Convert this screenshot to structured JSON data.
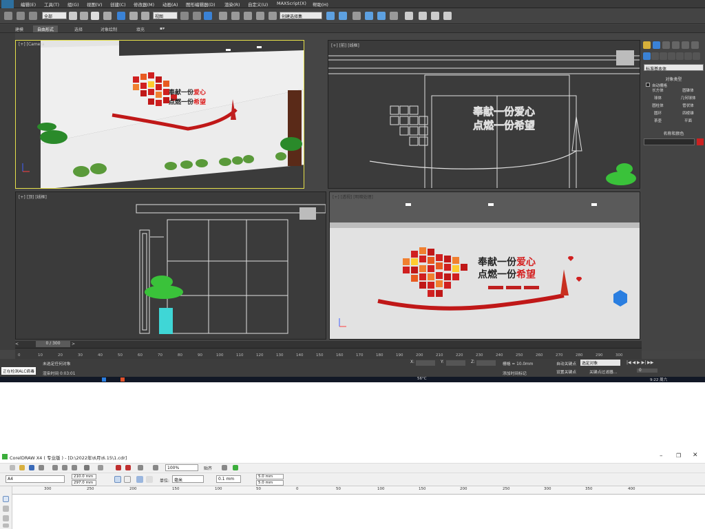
{
  "max": {
    "menu": [
      "编辑(E)",
      "工具(T)",
      "组(G)",
      "视图(V)",
      "创建(C)",
      "修改器(M)",
      "动画(A)",
      "图形编辑器(D)",
      "渲染(R)",
      "自定义(U)",
      "MAXScript(X)",
      "帮助(H)"
    ],
    "selection_filter": "全部",
    "view_dropdown": "视图",
    "named_selection": "创建选择集",
    "ribbon_tabs": [
      "建模",
      "自由形式",
      "选择",
      "对象绘制",
      "填充"
    ],
    "viewports": {
      "camera": "[+] [Camera",
      "front": "[+] [前] [线框]",
      "top": "[+] [顶] [线框]",
      "perspective": "[+] [透视] [明暗处理]"
    },
    "wall_text": {
      "line1_a": "奉献一份",
      "line1_b": "爱心",
      "line2_a": "点燃一份",
      "line2_b": "希望"
    },
    "command_panel": {
      "primitive_dropdown": "标准基本体",
      "object_type_header": "对象类型",
      "autogrid_label": "自动栅格",
      "buttons": [
        "长方体",
        "圆锥体",
        "球体",
        "几何球体",
        "圆柱体",
        "管状体",
        "圆环",
        "四棱锥",
        "茶壶",
        "平面"
      ],
      "name_color_header": "名称和颜色"
    },
    "timeline": {
      "frame_counter": "0 / 300",
      "ticks": [
        "0",
        "10",
        "20",
        "30",
        "40",
        "50",
        "60",
        "70",
        "80",
        "90",
        "100",
        "110",
        "120",
        "130",
        "140",
        "150",
        "160",
        "170",
        "180",
        "190",
        "200",
        "210",
        "220",
        "230",
        "240",
        "250",
        "260",
        "270",
        "280",
        "290",
        "300"
      ]
    },
    "status": {
      "left_box": "正在检测ALC病毒",
      "selection_msg": "未选定任何对象",
      "render_time": "渲染时间 0:03:01",
      "x_label": "X:",
      "y_label": "Y:",
      "z_label": "Z:",
      "grid": "栅格 = 10.0mm",
      "add_time_tag": "添加时间标记",
      "auto_key": "自动关键点",
      "set_key": "设置关键点",
      "key_filters": "关键点过滤器...",
      "selected_object": "选定对象",
      "frame_field": "0",
      "clock": "9:22 周六",
      "temperature": "56°C"
    }
  },
  "cdr": {
    "title": "CorelDRAW X4 ( 专业版 ) - [D:\\2022年\\6月\\6.15\\1.cdr]",
    "zoom": "100%",
    "snap": "贴齐",
    "page_size": "A4",
    "width": "210.0 mm",
    "height": "297.0 mm",
    "units_label": "单位:",
    "units": "毫米",
    "nudge": "0.1 mm",
    "dup_x": "5.0 mm",
    "dup_y": "5.0 mm",
    "ruler_ticks": [
      "300",
      "250",
      "200",
      "150",
      "100",
      "50",
      "0",
      "50",
      "100",
      "150",
      "200",
      "250",
      "300",
      "350",
      "400"
    ]
  }
}
